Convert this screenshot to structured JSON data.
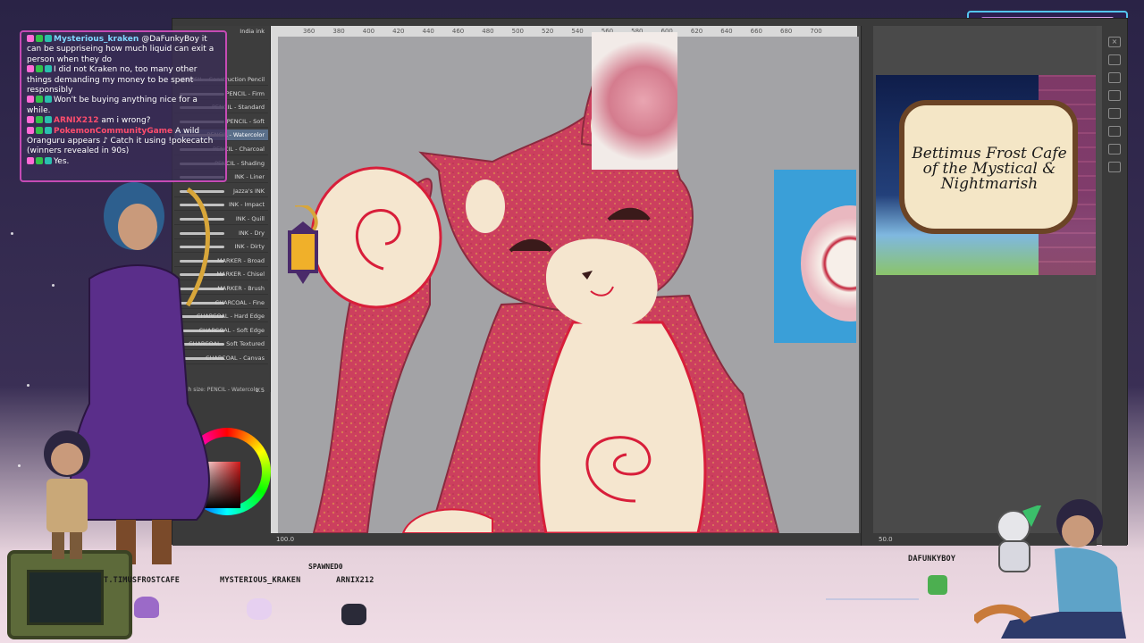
{
  "app": {
    "brushes": [
      "PENCIL - Construction Pencil",
      "PENCIL - Firm",
      "PENCIL - Standard",
      "PENCIL - Soft",
      "PENCIL - Watercolor",
      "PENCIL - Charcoal",
      "PENCIL - Shading",
      "INK - Liner",
      "Jazza's INK",
      "INK - Impact",
      "INK - Quill",
      "INK - Dry",
      "INK - Dirty",
      "MARKER - Broad",
      "MARKER - Chisel",
      "MARKER - Brush",
      "CHARCOAL - Fine",
      "CHARCOAL - Hard Edge",
      "CHARCOAL - Soft Edge",
      "CHARCOAL - Soft Textured",
      "CHARCOAL - Canvas"
    ],
    "selected_brush_index": 4,
    "ink_label": "India ink",
    "brush_size_label": "Brush size: PENCIL - Watercolor",
    "brush_size_value": "1.5",
    "ruler_ticks": [
      "360",
      "380",
      "400",
      "420",
      "440",
      "460",
      "480",
      "500",
      "520",
      "540",
      "560",
      "580",
      "600",
      "620",
      "640",
      "660",
      "680",
      "700"
    ],
    "canvas_zoom": "100.0",
    "nav_zoom": "50.0"
  },
  "banner": {
    "title": "Bettimus Frost Cafe of the Mystical & Nightmarish"
  },
  "chat": {
    "messages": [
      {
        "user": "Mysterious_kraken",
        "text": "@DaFunkyBoy it can be suppriseing how much liquid can exit a person when they do",
        "user_color": "#7fd7ff"
      },
      {
        "user": "",
        "text": "I did not Kraken no, too many other things demanding my money to be spent responsibly",
        "user_color": "#ffffff"
      },
      {
        "user": "",
        "text": "Won't be buying anything nice for a while.",
        "user_color": "#ffffff"
      },
      {
        "user": "ARNIX212",
        "text": "am i wrong?",
        "user_color": "#ff4d6d"
      },
      {
        "user": "PokemonCommunityGame",
        "text": "A wild Oranguru appears ♪ Catch it using !pokecatch (winners revealed in 90s)",
        "user_color": "#ff4d6d"
      },
      {
        "user": "",
        "text": "Yes.",
        "user_color": "#ffffff"
      }
    ]
  },
  "footer": {
    "spawned_label": "SPAWNED0",
    "names": [
      "T.TIMUSFROSTCAFE",
      "MYSTERIOUS_KRAKEN",
      "ARNIX212",
      "DAFUNKYBOY"
    ]
  },
  "colors": {
    "cat_main": "#cc3f5e",
    "cat_cream": "#f5e6cf",
    "cat_outline": "#d81e3a",
    "chat_border": "#c54bb5",
    "canvas_bg": "#a3a3a6"
  }
}
